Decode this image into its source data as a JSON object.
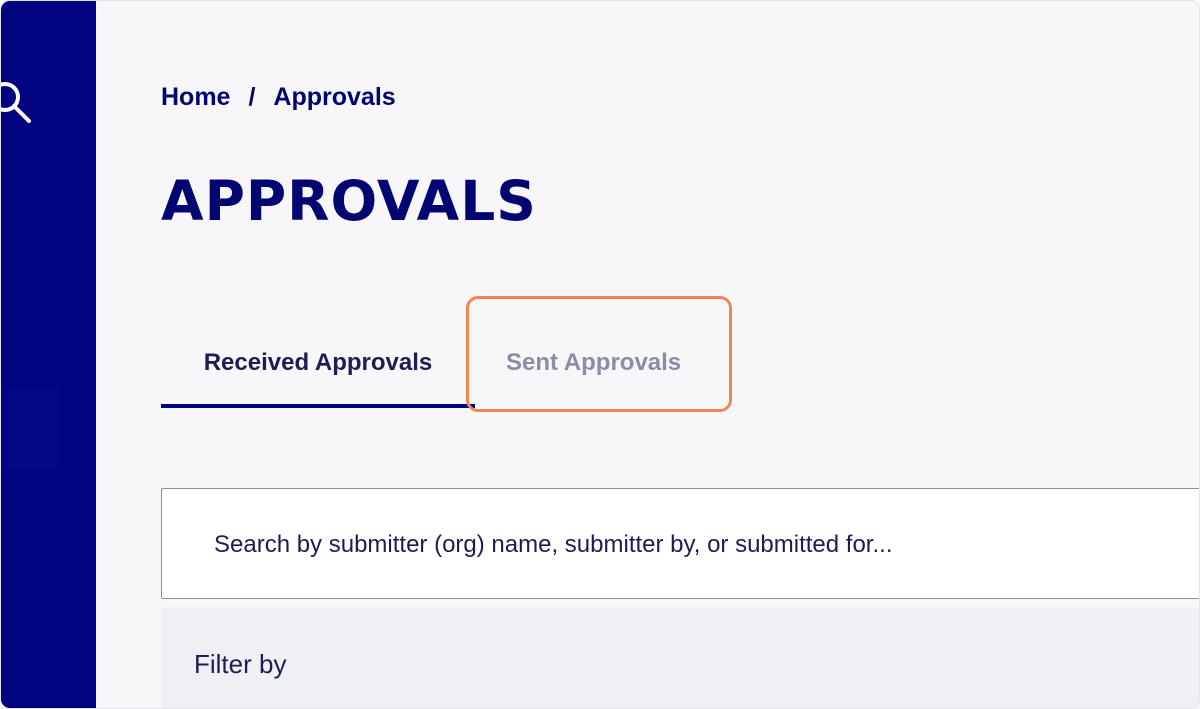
{
  "sidebar": {
    "search_icon": "search-icon"
  },
  "breadcrumb": {
    "home": "Home",
    "separator": "/",
    "current": "Approvals"
  },
  "page": {
    "title": "APPROVALS"
  },
  "tabs": [
    {
      "label": "Received Approvals",
      "active": true
    },
    {
      "label": "Sent Approvals",
      "active": false
    }
  ],
  "search": {
    "placeholder": "Search by submitter (org) name, submitter by, or submitted for..."
  },
  "filter": {
    "label": "Filter by"
  },
  "colors": {
    "brand_navy": "#020381",
    "text_dark": "#030570",
    "tab_inactive": "#8a8da6",
    "highlight": "#f08557"
  }
}
